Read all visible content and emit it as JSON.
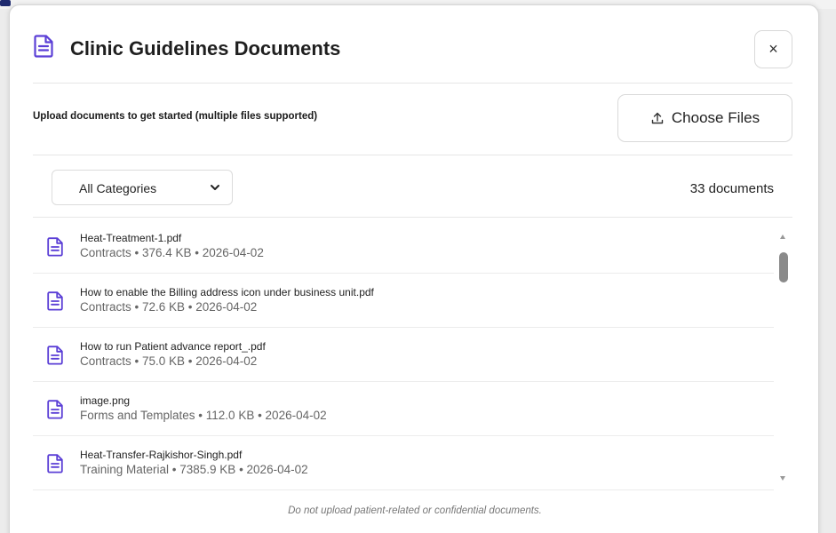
{
  "modal": {
    "title": "Clinic Guidelines Documents",
    "title_icon": "document-icon",
    "close_label": "×",
    "upload_prompt": "Upload documents to get started (multiple files supported)",
    "choose_files_label": "Choose Files",
    "category_filter": {
      "selected": "All Categories"
    },
    "doc_count": "33 documents",
    "footer_note": "Do not upload patient-related or confidential documents."
  },
  "documents": [
    {
      "name": "Heat-Treatment-1.pdf",
      "meta": "Contracts • 376.4 KB • 2026-04-02"
    },
    {
      "name": "How to enable the Billing address icon under business unit.pdf",
      "meta": "Contracts • 72.6 KB • 2026-04-02"
    },
    {
      "name": "How to run Patient advance report_.pdf",
      "meta": "Contracts • 75.0 KB • 2026-04-02"
    },
    {
      "name": "image.png",
      "meta": "Forms and Templates • 112.0 KB • 2026-04-02"
    },
    {
      "name": "Heat-Transfer-Rajkishor-Singh.pdf",
      "meta": "Training Material • 7385.9 KB • 2026-04-02"
    }
  ],
  "colors": {
    "accent": "#5b3fd6",
    "text": "#222222",
    "muted": "#666666"
  }
}
